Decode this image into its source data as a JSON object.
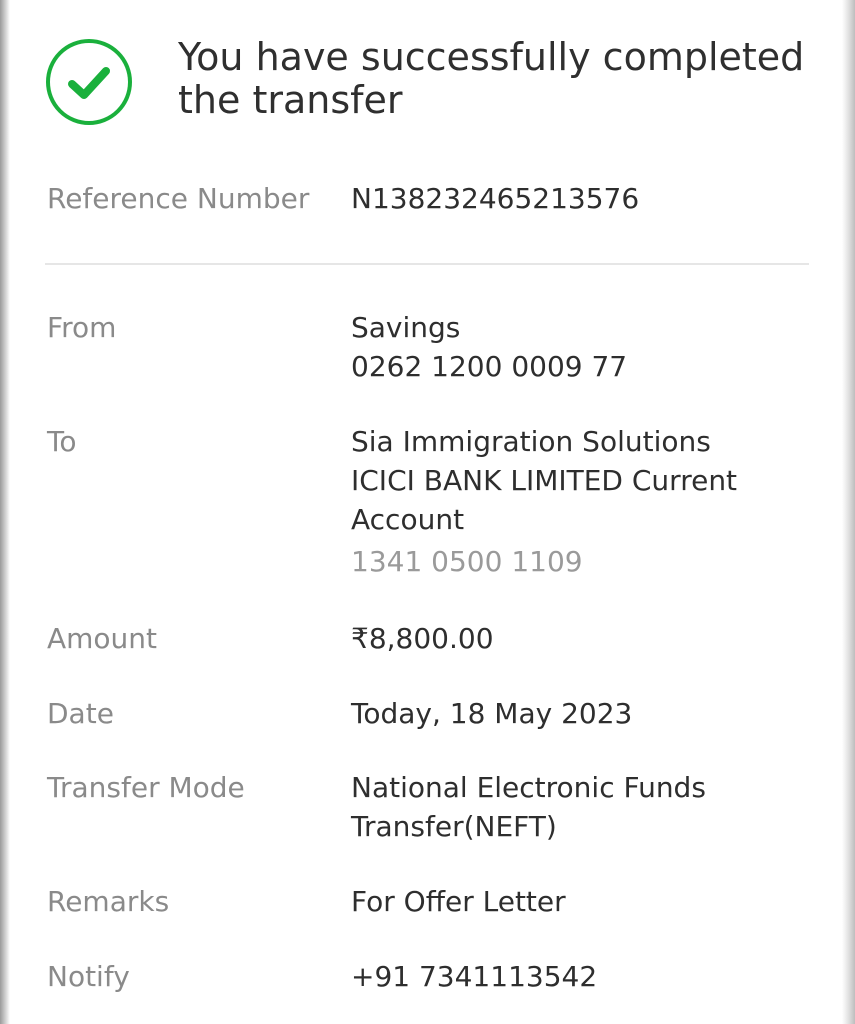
{
  "headline": "You have successfully completed the transfer",
  "icons": {
    "status": "check-circle-icon",
    "color": "#1ab03c"
  },
  "details": {
    "reference": {
      "label": "Reference Number",
      "value": "N138232465213576"
    },
    "from": {
      "label": "From",
      "account_type": "Savings",
      "account_number": "0262 1200 0009 77"
    },
    "to": {
      "label": "To",
      "payee_name": "Sia Immigration Solutions",
      "bank_line1": "ICICI BANK LIMITED Current",
      "bank_line2": "Account",
      "account_number": "1341 0500 1109"
    },
    "amount": {
      "label": "Amount",
      "value": "₹8,800.00"
    },
    "date": {
      "label": "Date",
      "value": "Today, 18 May 2023"
    },
    "transfer_mode": {
      "label": "Transfer Mode",
      "line1": "National Electronic Funds",
      "line2": "Transfer(NEFT)"
    },
    "remarks": {
      "label": "Remarks",
      "value": "For Offer Letter"
    },
    "notify": {
      "label": "Notify",
      "value": "+91 7341113542"
    }
  }
}
